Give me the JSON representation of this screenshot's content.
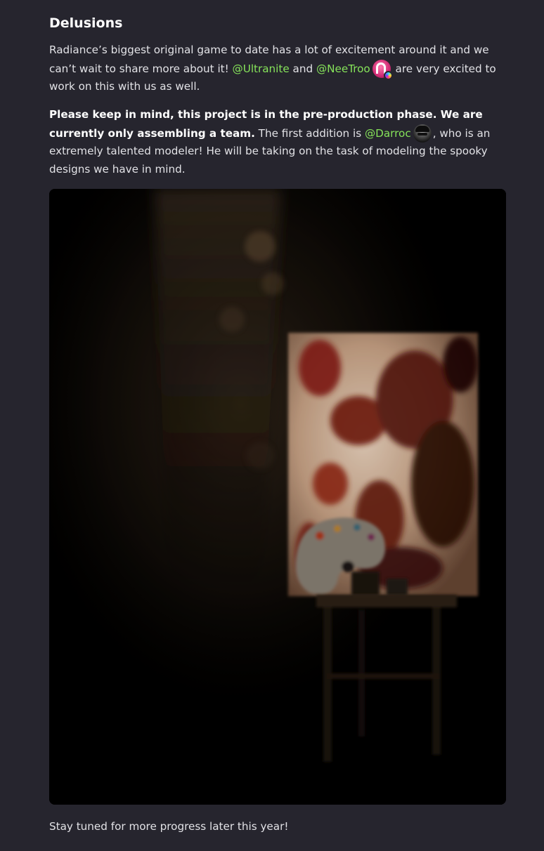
{
  "post": {
    "heading": "Delusions",
    "intro": {
      "text_a": "Radiance’s biggest original game to date has a lot of excitement around it and we can’t wait to share more about it! ",
      "mention_1": "@Ultranite",
      "text_b": " and ",
      "mention_2": "@NeeTroo",
      "text_c": " are very excited to work on this with us as well."
    },
    "team": {
      "bold": "Please keep in mind, this project is in the pre-production phase. We are currently only assembling a team.",
      "text_a": " The first addition is ",
      "mention": "@Darroc",
      "text_b": ", who is an extremely talented modeler! He will be taking on the task of modeling the spooky designs we have in mind."
    },
    "outro": "Stay tuned for more progress later this year!"
  },
  "colors": {
    "background": "#26252e",
    "mention": "#86e35a",
    "text": "#e2e2e6"
  },
  "icons": {
    "neetroo_avatar": "pink-avatar-icon",
    "neetroo_badge": "nitro-badge-icon",
    "darroc_avatar": "hat-avatar-icon"
  }
}
